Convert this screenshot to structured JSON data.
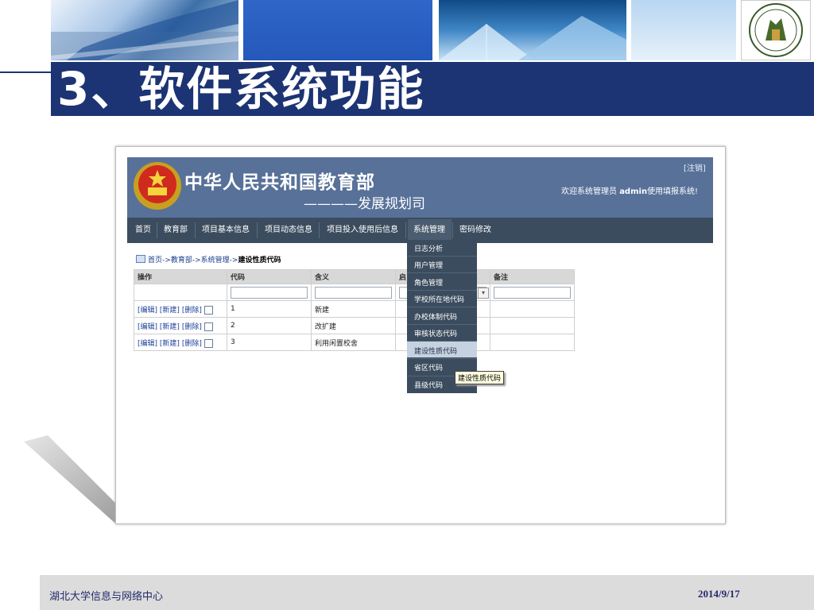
{
  "slide": {
    "title": "3、软件系统功能",
    "footer_left": "湖北大学信息与网络中心",
    "footer_right": "2014/9/17",
    "accent_color": "#1c3473",
    "logo_text": "1931",
    "logo_label": "HUBEI UNIVERSITY"
  },
  "app": {
    "org_title": "中华人民共和国教育部",
    "dept_title": "————发展规划司",
    "logout": "[注销]",
    "welcome_prefix": "欢迎系统管理员 ",
    "welcome_user": "admin",
    "welcome_suffix": "使用填报系统!",
    "nav": [
      "首页",
      "教育部",
      "项目基本信息",
      "项目动态信息",
      "项目投入使用后信息",
      "系统管理",
      "密码修改"
    ],
    "breadcrumb": {
      "home": "首页",
      "level1": "教育部",
      "level2": "系统管理",
      "current": "建设性质代码",
      "arrow": "->"
    },
    "table": {
      "headers": [
        "操作",
        "代码",
        "含义",
        "启",
        "备注"
      ],
      "op_edit": "[编辑]",
      "op_new": "[新建]",
      "op_delete": "[删除]",
      "rows": [
        {
          "code": "1",
          "meaning": "新建"
        },
        {
          "code": "2",
          "meaning": "改扩建"
        },
        {
          "code": "3",
          "meaning": "利用闲置校舍"
        }
      ]
    },
    "dropdown": [
      "日志分析",
      "用户管理",
      "角色管理",
      "学校所在地代码",
      "办校体制代码",
      "审核状态代码",
      "建设性质代码",
      "省区代码",
      "县级代码"
    ],
    "tooltip": "建设性质代码"
  }
}
